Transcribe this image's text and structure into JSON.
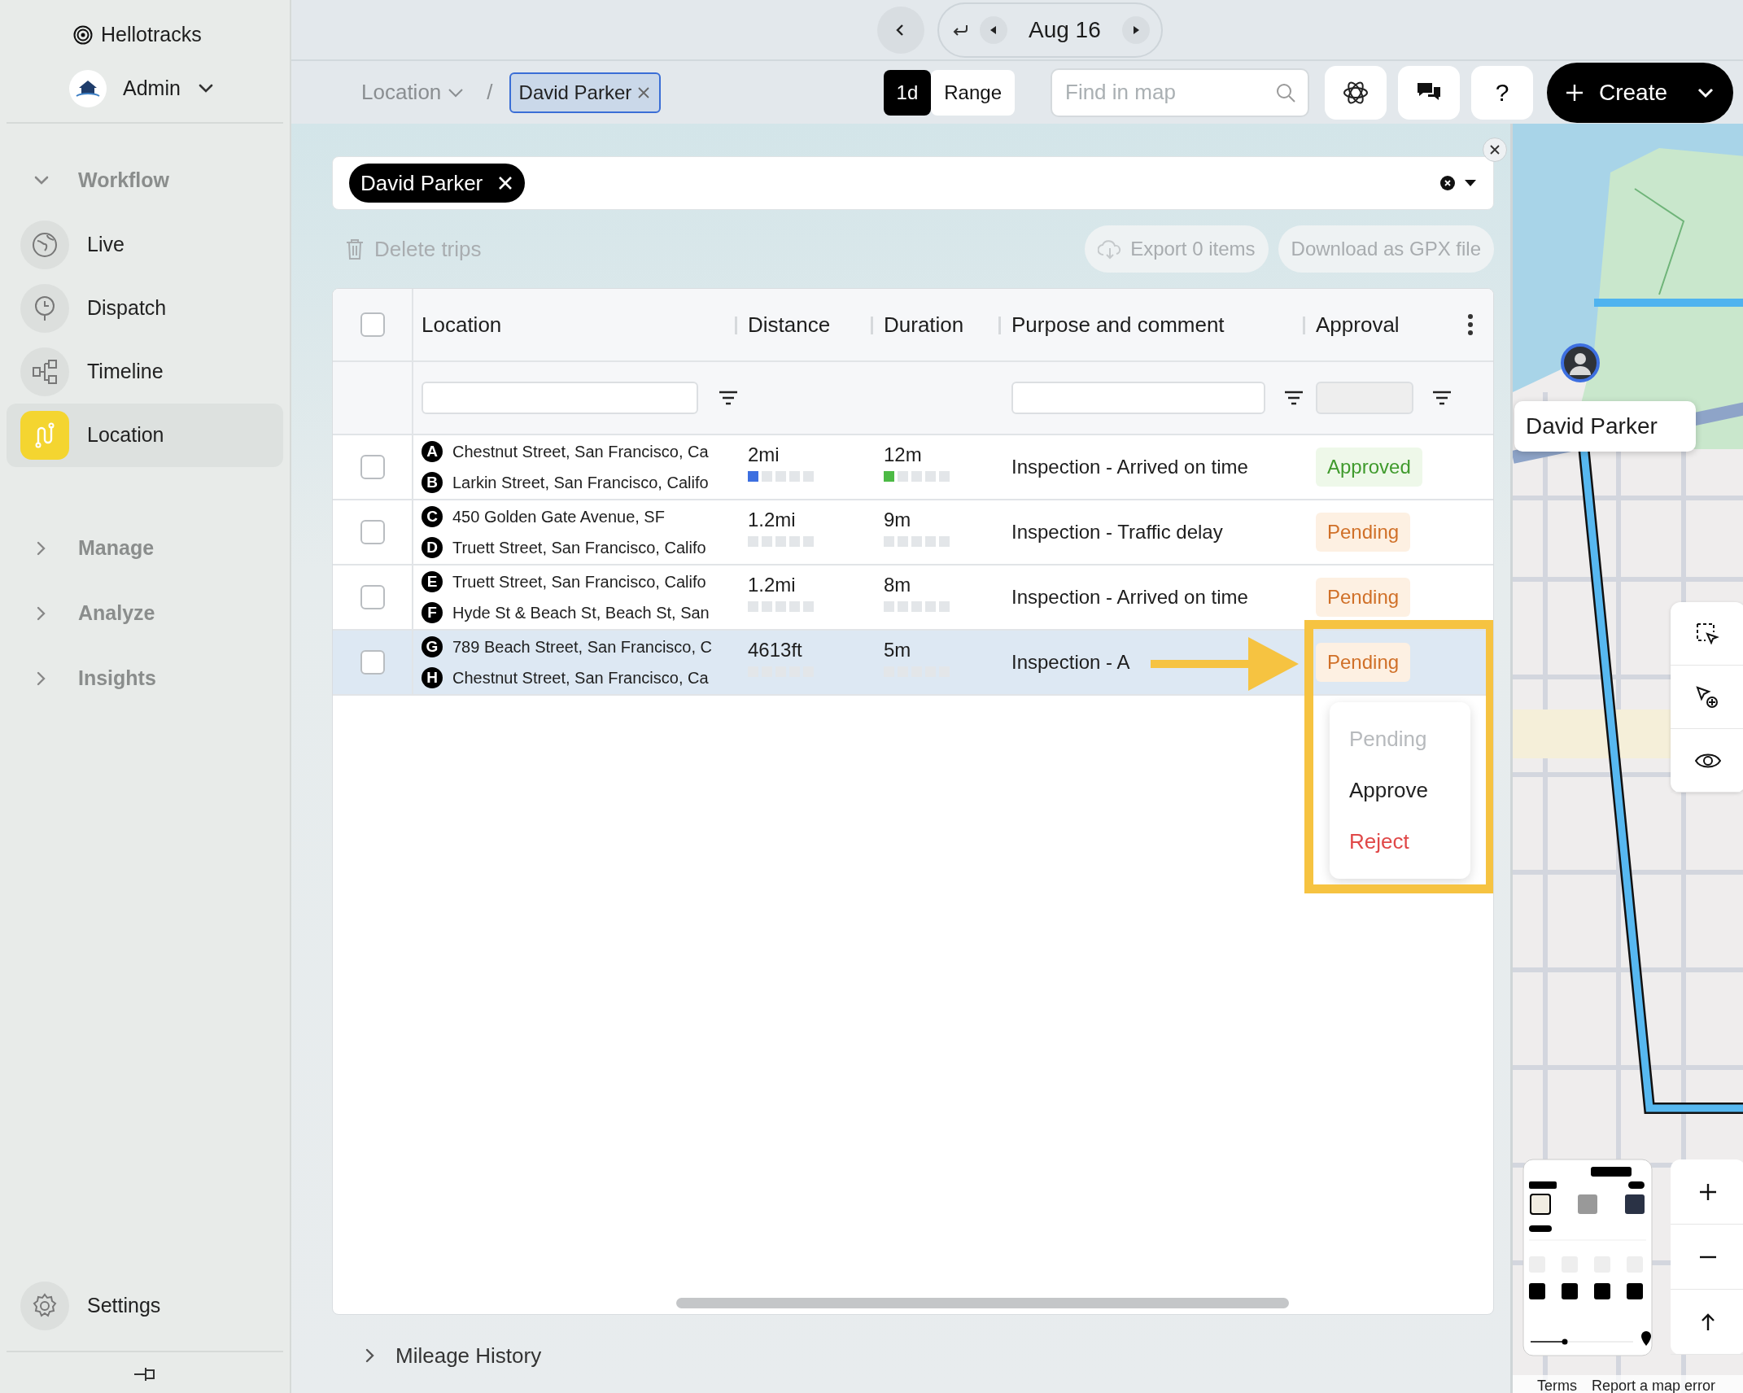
{
  "sidebar": {
    "brand": "Hellotracks",
    "account": "Admin",
    "groups": [
      {
        "label": "Workflow",
        "expanded": true,
        "items": [
          {
            "label": "Live",
            "selected": false
          },
          {
            "label": "Dispatch",
            "selected": false
          },
          {
            "label": "Timeline",
            "selected": false
          },
          {
            "label": "Location",
            "selected": true
          }
        ]
      },
      {
        "label": "Manage",
        "expanded": false
      },
      {
        "label": "Analyze",
        "expanded": false
      },
      {
        "label": "Insights",
        "expanded": false
      }
    ],
    "settings": "Settings"
  },
  "date_nav": {
    "date": "Aug 16"
  },
  "toolbar": {
    "breadcrumb": "Location",
    "separator": "/",
    "chip": "David Parker",
    "range_tabs": [
      {
        "label": "1d",
        "selected": true
      },
      {
        "label": "Range",
        "selected": false
      }
    ],
    "search": {
      "placeholder": "Find in map"
    },
    "help": "?",
    "create": "Create"
  },
  "filter": {
    "chips": [
      "David Parker"
    ]
  },
  "actions": {
    "delete": "Delete trips",
    "export": "Export 0 items",
    "download": "Download as GPX file"
  },
  "table": {
    "select_all": {
      "checked": false
    },
    "columns": [
      "Location",
      "Distance",
      "Duration",
      "Purpose and comment",
      "Approval"
    ],
    "rows": [
      {
        "selected": false,
        "checked": false,
        "stops": [
          {
            "marker": "A",
            "address": "Chestnut Street, San Francisco, Ca"
          },
          {
            "marker": "B",
            "address": "Larkin Street, San Francisco, Califo"
          }
        ],
        "distance": {
          "text": "2mi",
          "level": 0.2
        },
        "duration": {
          "text": "12m",
          "level": 0.2
        },
        "purpose": "Inspection - Arrived on time",
        "approval": {
          "text": "Approved",
          "kind": "approved"
        }
      },
      {
        "selected": false,
        "checked": false,
        "stops": [
          {
            "marker": "C",
            "address": "450 Golden Gate Avenue, SF"
          },
          {
            "marker": "D",
            "address": "Truett Street, San Francisco, Califo"
          }
        ],
        "distance": {
          "text": "1.2mi",
          "level": 0
        },
        "duration": {
          "text": "9m",
          "level": 0
        },
        "purpose": "Inspection - Traffic delay",
        "approval": {
          "text": "Pending",
          "kind": "pending"
        }
      },
      {
        "selected": false,
        "checked": false,
        "stops": [
          {
            "marker": "E",
            "address": "Truett Street, San Francisco, Califo"
          },
          {
            "marker": "F",
            "address": "Hyde St & Beach St, Beach St, San"
          }
        ],
        "distance": {
          "text": "1.2mi",
          "level": 0
        },
        "duration": {
          "text": "8m",
          "level": 0
        },
        "purpose": "Inspection - Arrived on time",
        "approval": {
          "text": "Pending",
          "kind": "pending"
        }
      },
      {
        "selected": true,
        "checked": false,
        "stops": [
          {
            "marker": "G",
            "address": "789 Beach Street, San Francisco, C"
          },
          {
            "marker": "H",
            "address": "Chestnut Street, San Francisco, Ca"
          }
        ],
        "distance": {
          "text": "4613ft",
          "level": 0
        },
        "duration": {
          "text": "5m",
          "level": 0
        },
        "purpose": "Inspection - A",
        "approval": {
          "text": "Pending",
          "kind": "pending"
        }
      }
    ]
  },
  "approval_menu": {
    "options": [
      {
        "label": "Pending",
        "kind": "disabled"
      },
      {
        "label": "Approve",
        "kind": "normal"
      },
      {
        "label": "Reject",
        "kind": "danger"
      }
    ]
  },
  "footer": {
    "label": "Mileage History",
    "expanded": false
  },
  "map": {
    "kind": "picture",
    "marker_label": "David Parker",
    "attribution": [
      "Terms",
      "Report a map error"
    ]
  }
}
